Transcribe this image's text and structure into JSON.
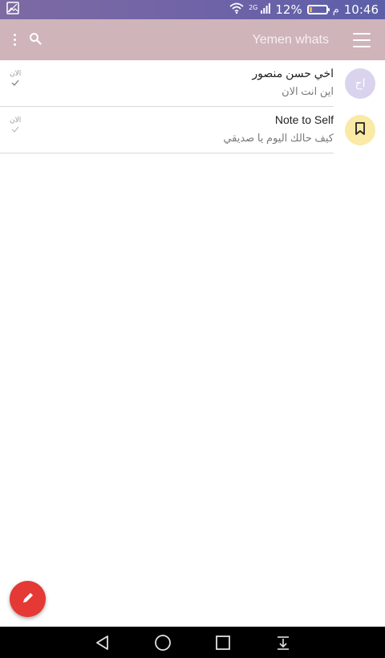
{
  "status_bar": {
    "time": "10:46",
    "ampm": "م",
    "battery": "12%",
    "battery_level": 0.12,
    "network_label": "2G",
    "icons": [
      "gallery-icon",
      "wifi-icon",
      "signal-icon",
      "battery-icon"
    ]
  },
  "app_bar": {
    "title": "Yemen whats",
    "icons": [
      "menu-icon",
      "search-icon",
      "more-vert-icon"
    ],
    "background": "#cfb4ba"
  },
  "chats": [
    {
      "name": "اخي حسن منصور",
      "preview": "اين انت الان",
      "time": "الان",
      "status": "sent",
      "avatar_text": "اح",
      "avatar_color": "#d9d3ee"
    },
    {
      "name": "Note to Self",
      "preview": "كيف حالك اليوم يا صديقي",
      "time": "الان",
      "status": "sent",
      "avatar_icon": "bookmark-icon",
      "avatar_color": "#fbe9a6"
    }
  ],
  "fab": {
    "icon": "pencil-icon",
    "color": "#e53935"
  },
  "nav_bar": {
    "icons": [
      "back-icon",
      "home-icon",
      "recents-icon",
      "notification-drawer-icon"
    ]
  }
}
